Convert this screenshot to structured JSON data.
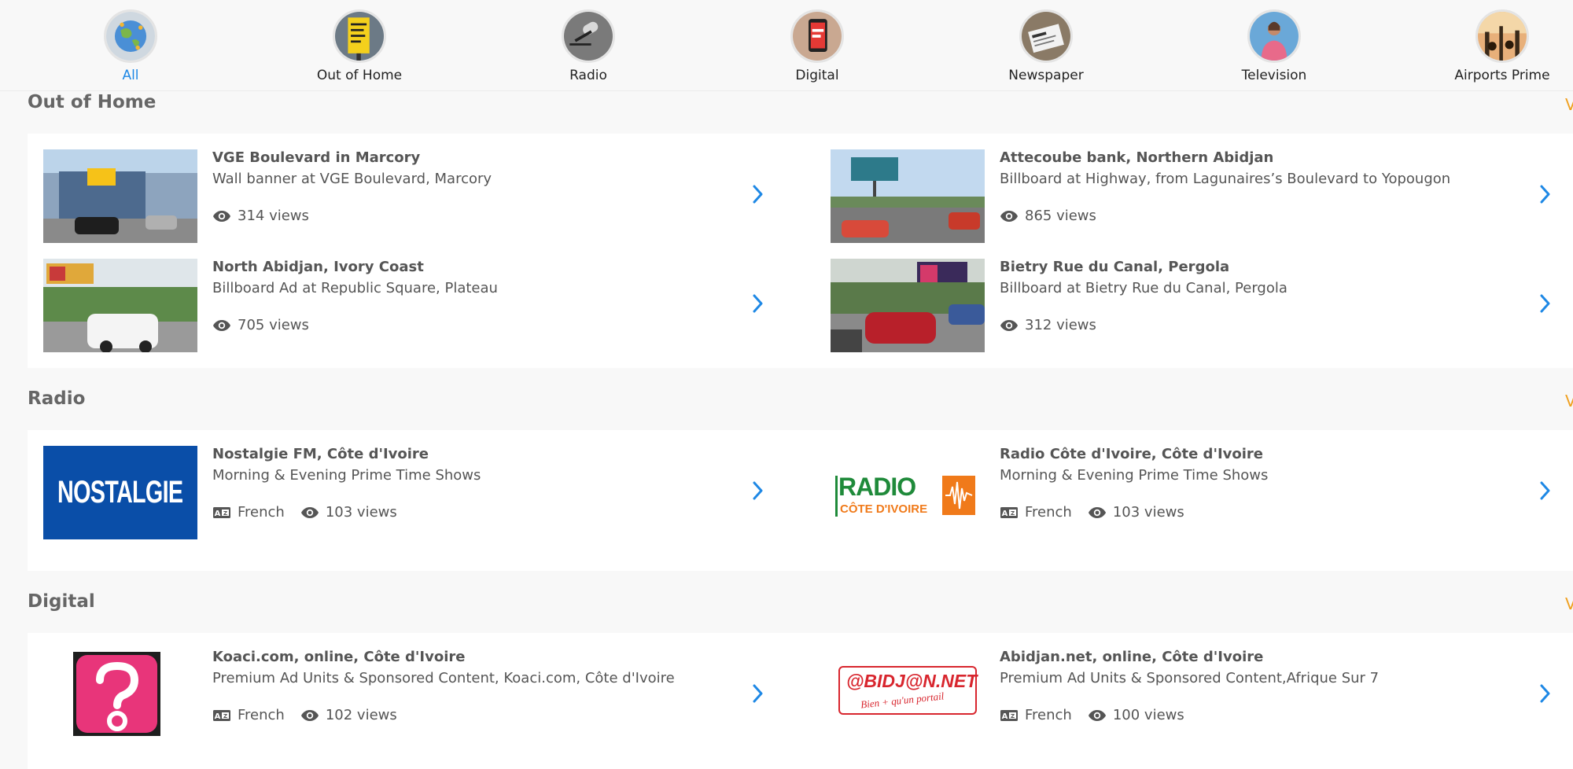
{
  "categories": [
    {
      "label": "All",
      "icon": "globe-icon",
      "active": true
    },
    {
      "label": "Out of Home",
      "icon": "advertising-poster-icon"
    },
    {
      "label": "Radio",
      "icon": "microphone-icon"
    },
    {
      "label": "Digital",
      "icon": "phone-icon"
    },
    {
      "label": "Newspaper",
      "icon": "newspaper-icon"
    },
    {
      "label": "Television",
      "icon": "tv-presenter-icon"
    },
    {
      "label": "Airports Prime",
      "icon": "airport-icon"
    }
  ],
  "sections": {
    "ooh": {
      "title": "Out of Home",
      "more": "V",
      "items": [
        {
          "title": "VGE Boulevard in Marcory",
          "subtitle": "Wall banner at VGE Boulevard, Marcory",
          "views": "314 views"
        },
        {
          "title": "Attecoube bank, Northern Abidjan",
          "subtitle": "Billboard at Highway, from Lagunaires’s Boulevard to Yopougon",
          "views": "865 views"
        },
        {
          "title": "North Abidjan, Ivory Coast",
          "subtitle": "Billboard Ad at Republic Square, Plateau",
          "views": "705 views"
        },
        {
          "title": "Bietry Rue du Canal, Pergola",
          "subtitle": "Billboard at Bietry Rue du Canal, Pergola",
          "views": "312 views"
        }
      ]
    },
    "radio": {
      "title": "Radio",
      "more": "V",
      "logo_nostalgie": "NOSTALGIE",
      "logo_radio_word": "RADIO",
      "logo_radio_sub": "CÔTE D'IVOIRE",
      "items": [
        {
          "title": "Nostalgie FM, Côte d'Ivoire",
          "subtitle": "Morning & Evening Prime Time Shows",
          "language": "French",
          "views": "103 views"
        },
        {
          "title": "Radio Côte d'Ivoire, Côte d'Ivoire",
          "subtitle": "Morning & Evening Prime Time Shows",
          "language": "French",
          "views": "103 views"
        }
      ]
    },
    "digital": {
      "title": "Digital",
      "more": "V",
      "logo_abidjan": "@BIDJ@N.NET",
      "logo_abidjan_tag": "Bien + qu'un portail",
      "items": [
        {
          "title": "Koaci.com, online, Côte d'Ivoire",
          "subtitle": "Premium Ad Units & Sponsored Content, Koaci.com, Côte d'Ivoire",
          "language": "French",
          "views": "102 views"
        },
        {
          "title": "Abidjan.net, online, Côte d'Ivoire",
          "subtitle": "Premium Ad Units & Sponsored Content,Afrique Sur 7",
          "language": "French",
          "views": "100 views"
        }
      ]
    }
  },
  "colors": {
    "accent": "#1e88e5",
    "more": "#f0a020",
    "nostalgie_bg": "#0a4ea8",
    "radio_green": "#1f8a3a",
    "radio_orange": "#f07a1a",
    "koaci_pink": "#e8357a"
  }
}
